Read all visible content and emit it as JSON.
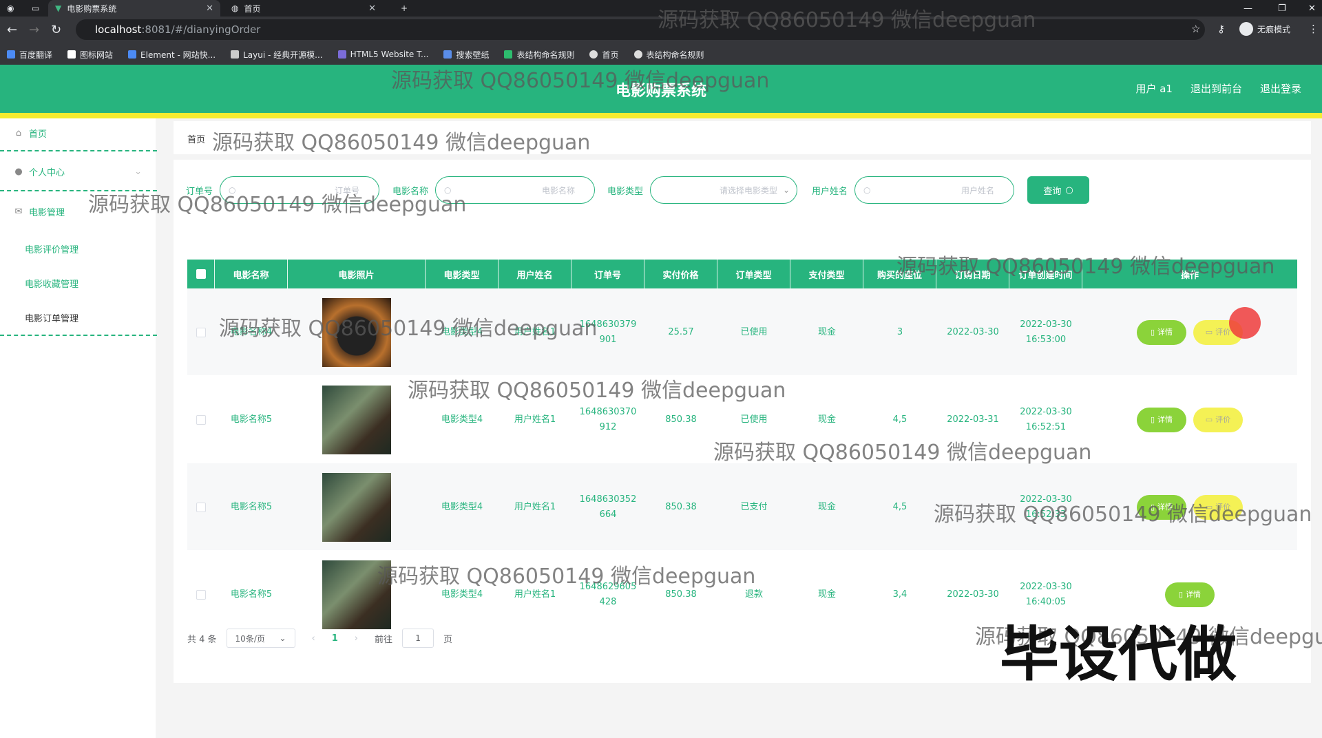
{
  "browser": {
    "tabs": [
      {
        "label": "电影购票系统",
        "active": true
      },
      {
        "label": "首页",
        "active": false
      }
    ],
    "url_host": "localhost",
    "url_path": ":8081/#/dianyingOrder",
    "incognito_label": "无痕模式",
    "bookmarks": [
      "百度翻译",
      "图标网站",
      "Element - 网站快...",
      "Layui - 经典开源模...",
      "HTML5 Website T...",
      "搜索壁纸",
      "表结构命名规则",
      "首页",
      "表结构命名规则"
    ]
  },
  "header": {
    "title": "电影购票系统",
    "links": [
      "用户 a1",
      "退出到前台",
      "退出登录"
    ]
  },
  "sidebar": {
    "home": "首页",
    "personal": "个人中心",
    "movie_mgmt": "电影管理",
    "subs": [
      "电影评价管理",
      "电影收藏管理",
      "电影订单管理"
    ]
  },
  "breadcrumb": "首页",
  "filters": {
    "order_label": "订单号",
    "order_ph": "订单号",
    "name_label": "电影名称",
    "name_ph": "电影名称",
    "type_label": "电影类型",
    "type_ph": "请选择电影类型",
    "user_label": "用户姓名",
    "user_ph": "用户姓名",
    "query": "查询"
  },
  "table": {
    "headers": [
      "电影名称",
      "电影照片",
      "电影类型",
      "用户姓名",
      "订单号",
      "实付价格",
      "订单类型",
      "支付类型",
      "购买的座位",
      "订购日期",
      "订单创建时间",
      "操作"
    ],
    "rows": [
      {
        "name": "电影名称4",
        "type": "电影类型4",
        "user": "用户姓名1",
        "order1": "1648630379",
        "order2": "901",
        "price": "25.57",
        "otype": "已使用",
        "pay": "现金",
        "seat": "3",
        "date": "2022-03-30",
        "ct1": "2022-03-30",
        "ct2": "16:53:00",
        "actions": [
          "详情",
          "评价"
        ]
      },
      {
        "name": "电影名称5",
        "type": "电影类型4",
        "user": "用户姓名1",
        "order1": "1648630370",
        "order2": "912",
        "price": "850.38",
        "otype": "已使用",
        "pay": "现金",
        "seat": "4,5",
        "date": "2022-03-31",
        "ct1": "2022-03-30",
        "ct2": "16:52:51",
        "actions": [
          "详情",
          "评价"
        ]
      },
      {
        "name": "电影名称5",
        "type": "电影类型4",
        "user": "用户姓名1",
        "order1": "1648630352",
        "order2": "664",
        "price": "850.38",
        "otype": "已支付",
        "pay": "现金",
        "seat": "4,5",
        "date": "",
        "ct1": "2022-03-30",
        "ct2": "16:52:33",
        "actions": [
          "详情",
          "评价"
        ]
      },
      {
        "name": "电影名称5",
        "type": "电影类型4",
        "user": "用户姓名1",
        "order1": "1648629605",
        "order2": "428",
        "price": "850.38",
        "otype": "退款",
        "pay": "现金",
        "seat": "3,4",
        "date": "2022-03-30",
        "ct1": "2022-03-30",
        "ct2": "16:40:05",
        "actions": [
          "详情"
        ]
      }
    ]
  },
  "pager": {
    "total": "共 4 条",
    "page_size": "10条/页",
    "current": "1",
    "goto_label": "前往",
    "goto_value": "1",
    "page_suffix": "页"
  },
  "watermark": "源码获取 QQ86050149 微信deepguan",
  "big_watermark": "毕设代做"
}
